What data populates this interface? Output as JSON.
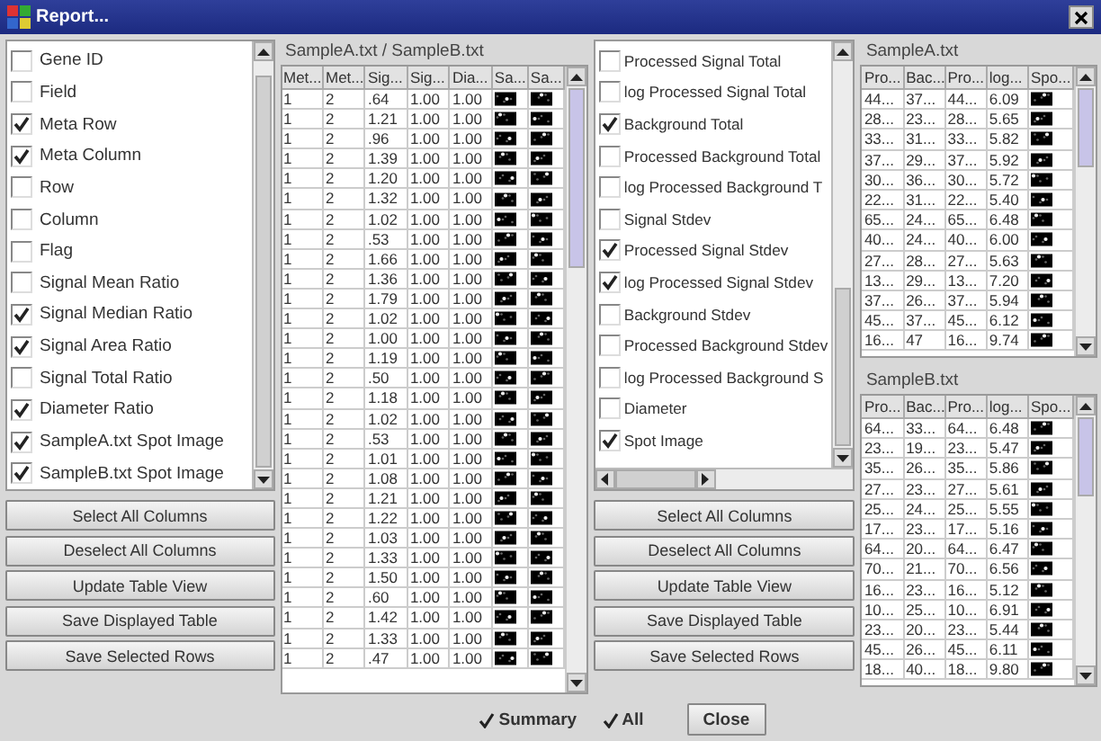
{
  "window": {
    "title": "Report..."
  },
  "left_columns": {
    "items": [
      {
        "label": "Gene ID",
        "checked": false
      },
      {
        "label": "Field",
        "checked": false
      },
      {
        "label": "Meta Row",
        "checked": true
      },
      {
        "label": "Meta Column",
        "checked": true
      },
      {
        "label": "Row",
        "checked": false
      },
      {
        "label": "Column",
        "checked": false
      },
      {
        "label": "Flag",
        "checked": false
      },
      {
        "label": "Signal Mean Ratio",
        "checked": false
      },
      {
        "label": "Signal Median Ratio",
        "checked": true
      },
      {
        "label": "Signal Area Ratio",
        "checked": true
      },
      {
        "label": "Signal Total Ratio",
        "checked": false
      },
      {
        "label": "Diameter Ratio",
        "checked": true
      },
      {
        "label": "SampleA.txt Spot Image",
        "checked": true
      },
      {
        "label": "SampleB.txt Spot Image",
        "checked": true
      }
    ]
  },
  "left_buttons": [
    "Select All Columns",
    "Deselect All Columns",
    "Update Table View",
    "Save Displayed Table",
    "Save Selected Rows"
  ],
  "comparison": {
    "title": "SampleA.txt / SampleB.txt",
    "columns": [
      {
        "label": "Met...",
        "kind": "text"
      },
      {
        "label": "Met...",
        "kind": "text"
      },
      {
        "label": "Sig...",
        "kind": "text"
      },
      {
        "label": "Sig...",
        "kind": "text"
      },
      {
        "label": "Dia...",
        "kind": "text"
      },
      {
        "label": "Sa..."
      },
      {
        "label": "Sa..."
      }
    ],
    "rows": [
      [
        "1",
        "2",
        ".64",
        "1.00",
        "1.00"
      ],
      [
        "1",
        "2",
        "1.21",
        "1.00",
        "1.00"
      ],
      [
        "1",
        "2",
        ".96",
        "1.00",
        "1.00"
      ],
      [
        "1",
        "2",
        "1.39",
        "1.00",
        "1.00"
      ],
      [
        "1",
        "2",
        "1.20",
        "1.00",
        "1.00"
      ],
      [
        "1",
        "2",
        "1.32",
        "1.00",
        "1.00"
      ],
      [
        "1",
        "2",
        "1.02",
        "1.00",
        "1.00"
      ],
      [
        "1",
        "2",
        ".53",
        "1.00",
        "1.00"
      ],
      [
        "1",
        "2",
        "1.66",
        "1.00",
        "1.00"
      ],
      [
        "1",
        "2",
        "1.36",
        "1.00",
        "1.00"
      ],
      [
        "1",
        "2",
        "1.79",
        "1.00",
        "1.00"
      ],
      [
        "1",
        "2",
        "1.02",
        "1.00",
        "1.00"
      ],
      [
        "1",
        "2",
        "1.00",
        "1.00",
        "1.00"
      ],
      [
        "1",
        "2",
        "1.19",
        "1.00",
        "1.00"
      ],
      [
        "1",
        "2",
        ".50",
        "1.00",
        "1.00"
      ],
      [
        "1",
        "2",
        "1.18",
        "1.00",
        "1.00"
      ],
      [
        "1",
        "2",
        "1.02",
        "1.00",
        "1.00"
      ],
      [
        "1",
        "2",
        ".53",
        "1.00",
        "1.00"
      ],
      [
        "1",
        "2",
        "1.01",
        "1.00",
        "1.00"
      ],
      [
        "1",
        "2",
        "1.08",
        "1.00",
        "1.00"
      ],
      [
        "1",
        "2",
        "1.21",
        "1.00",
        "1.00"
      ],
      [
        "1",
        "2",
        "1.22",
        "1.00",
        "1.00"
      ],
      [
        "1",
        "2",
        "1.03",
        "1.00",
        "1.00"
      ],
      [
        "1",
        "2",
        "1.33",
        "1.00",
        "1.00"
      ],
      [
        "1",
        "2",
        "1.50",
        "1.00",
        "1.00"
      ],
      [
        "1",
        "2",
        ".60",
        "1.00",
        "1.00"
      ],
      [
        "1",
        "2",
        "1.42",
        "1.00",
        "1.00"
      ],
      [
        "1",
        "2",
        "1.33",
        "1.00",
        "1.00"
      ],
      [
        "1",
        "2",
        ".47",
        "1.00",
        "1.00"
      ]
    ]
  },
  "right_columns": {
    "items": [
      {
        "label": "Processed Signal Total",
        "checked": false
      },
      {
        "label": "log Processed Signal Total",
        "checked": false
      },
      {
        "label": "Background Total",
        "checked": true
      },
      {
        "label": "Processed Background Total",
        "checked": false
      },
      {
        "label": "log Processed Background T",
        "checked": false
      },
      {
        "label": "Signal Stdev",
        "checked": false
      },
      {
        "label": "Processed Signal Stdev",
        "checked": true
      },
      {
        "label": "log Processed Signal Stdev",
        "checked": true
      },
      {
        "label": "Background Stdev",
        "checked": false
      },
      {
        "label": "Processed Background Stdev",
        "checked": false
      },
      {
        "label": "log Processed Background S",
        "checked": false
      },
      {
        "label": "Diameter",
        "checked": false
      },
      {
        "label": "Spot Image",
        "checked": true
      }
    ]
  },
  "right_buttons": [
    "Select All Columns",
    "Deselect All Columns",
    "Update Table View",
    "Save Displayed Table",
    "Save Selected Rows"
  ],
  "sample_tables": [
    {
      "title": "SampleA.txt",
      "columns": [
        {
          "label": "Pro...",
          "kind": "text"
        },
        {
          "label": "Bac...",
          "kind": "text"
        },
        {
          "label": "Pro...",
          "kind": "text"
        },
        {
          "label": "log...",
          "kind": "text"
        },
        {
          "label": "Spo..."
        }
      ],
      "rows": [
        [
          "44...",
          "37...",
          "44...",
          "6.09"
        ],
        [
          "28...",
          "23...",
          "28...",
          "5.65"
        ],
        [
          "33...",
          "31...",
          "33...",
          "5.82"
        ],
        [
          "37...",
          "29...",
          "37...",
          "5.92"
        ],
        [
          "30...",
          "36...",
          "30...",
          "5.72"
        ],
        [
          "22...",
          "31...",
          "22...",
          "5.40"
        ],
        [
          "65...",
          "24...",
          "65...",
          "6.48"
        ],
        [
          "40...",
          "24...",
          "40...",
          "6.00"
        ],
        [
          "27...",
          "28...",
          "27...",
          "5.63"
        ],
        [
          "13...",
          "29...",
          "13...",
          "7.20"
        ],
        [
          "37...",
          "26...",
          "37...",
          "5.94"
        ],
        [
          "45...",
          "37...",
          "45...",
          "6.12"
        ],
        [
          "16...",
          "47",
          "16...",
          "9.74"
        ]
      ]
    },
    {
      "title": "SampleB.txt",
      "columns": [
        {
          "label": "Pro...",
          "kind": "text"
        },
        {
          "label": "Bac...",
          "kind": "text"
        },
        {
          "label": "Pro...",
          "kind": "text"
        },
        {
          "label": "log...",
          "kind": "text"
        },
        {
          "label": "Spo..."
        }
      ],
      "rows": [
        [
          "64...",
          "33...",
          "64...",
          "6.48"
        ],
        [
          "23...",
          "19...",
          "23...",
          "5.47"
        ],
        [
          "35...",
          "26...",
          "35...",
          "5.86"
        ],
        [
          "27...",
          "23...",
          "27...",
          "5.61"
        ],
        [
          "25...",
          "24...",
          "25...",
          "5.55"
        ],
        [
          "17...",
          "23...",
          "17...",
          "5.16"
        ],
        [
          "64...",
          "20...",
          "64...",
          "6.47"
        ],
        [
          "70...",
          "21...",
          "70...",
          "6.56"
        ],
        [
          "16...",
          "23...",
          "16...",
          "5.12"
        ],
        [
          "10...",
          "25...",
          "10...",
          "6.91"
        ],
        [
          "23...",
          "20...",
          "23...",
          "5.44"
        ],
        [
          "45...",
          "26...",
          "45...",
          "6.11"
        ],
        [
          "18...",
          "40...",
          "18...",
          "9.80"
        ]
      ]
    }
  ],
  "footer": {
    "options": [
      {
        "label": "Summary",
        "checked": true
      },
      {
        "label": "All",
        "checked": true
      }
    ],
    "close_button": "Close"
  }
}
